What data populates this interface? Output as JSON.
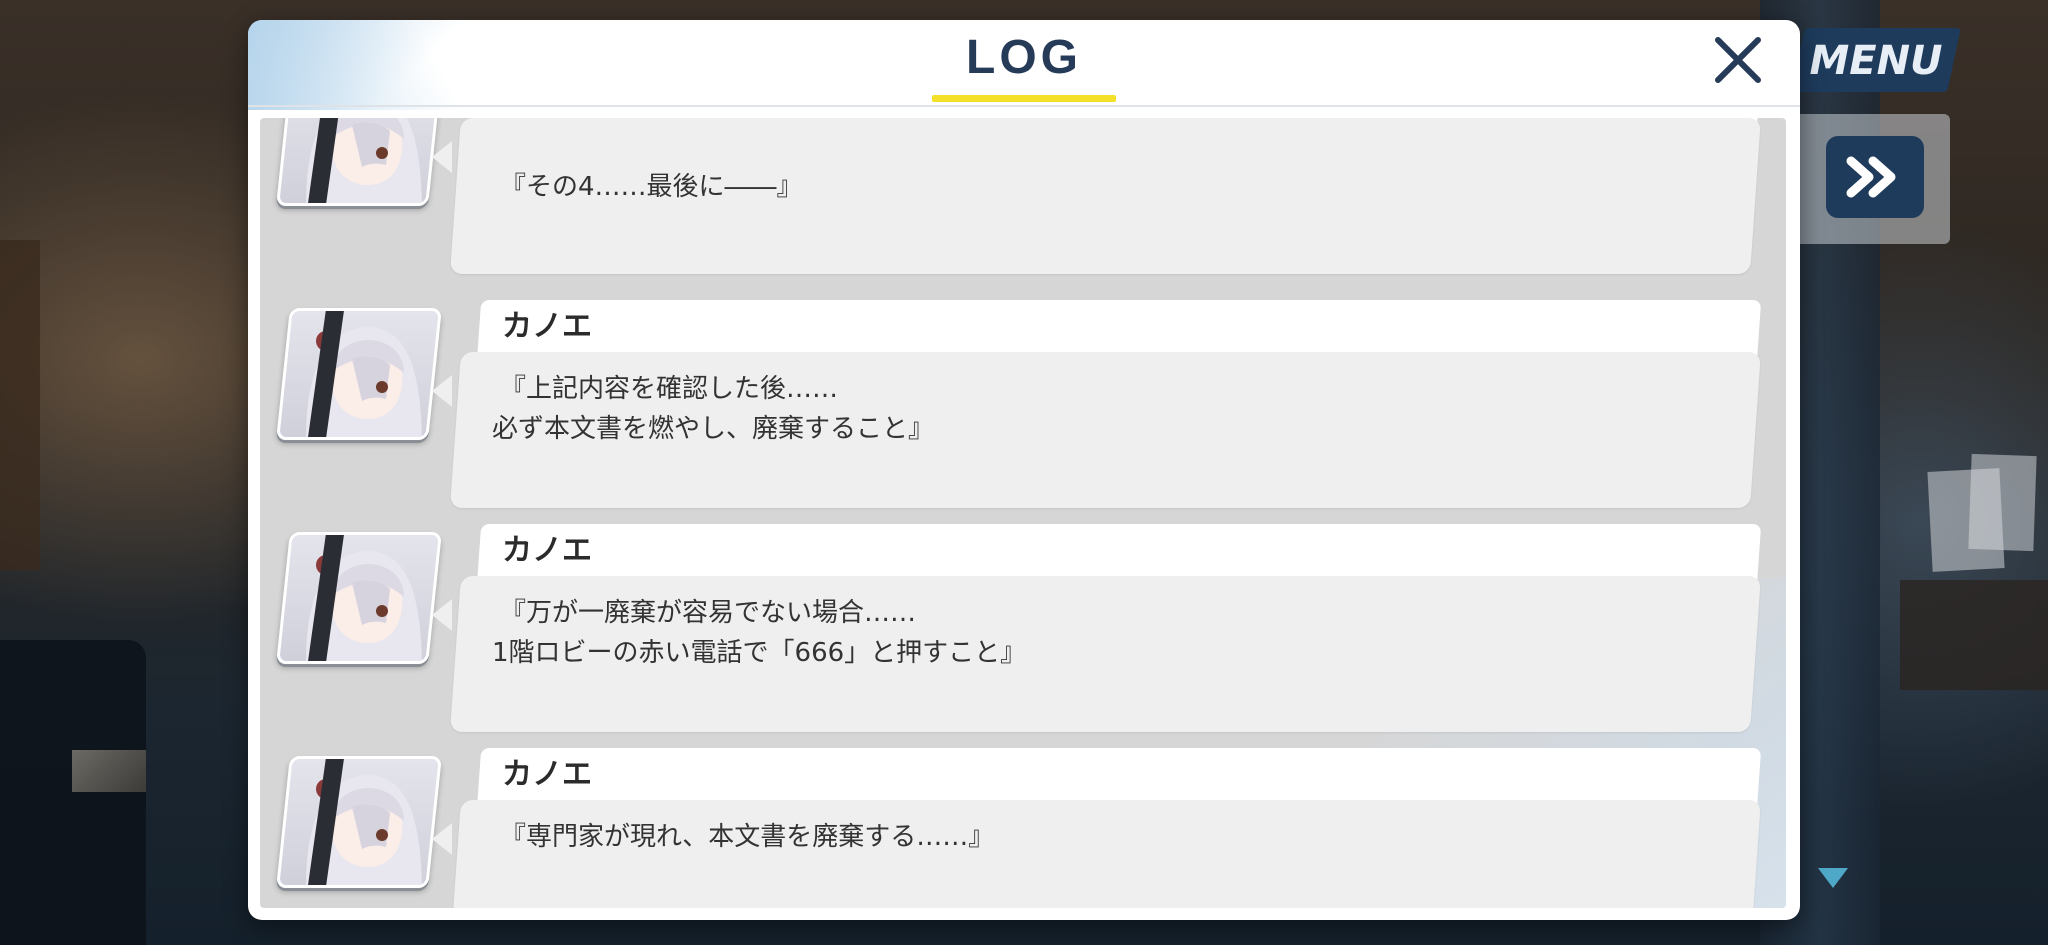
{
  "header": {
    "title": "LOG"
  },
  "hud": {
    "menu_label": "MENU"
  },
  "log": {
    "entries": [
      {
        "speaker": "",
        "lines": [
          "『その4……最後に――』"
        ]
      },
      {
        "speaker": "カノエ",
        "lines": [
          "『上記内容を確認した後……",
          "必ず本文書を燃やし、廃棄すること』"
        ]
      },
      {
        "speaker": "カノエ",
        "lines": [
          "『万が一廃棄が容易でない場合……",
          "1階ロビーの赤い電話で「666」と押すこと』"
        ]
      },
      {
        "speaker": "カノエ",
        "lines": [
          "『専門家が現れ、本文書を廃棄する……』"
        ]
      }
    ]
  },
  "colors": {
    "title": "#263b58",
    "title_underline": "#f4e02a",
    "menu_button": "#1e3b5c",
    "bubble": "#efefef",
    "log_background": "#d6d6d6"
  }
}
